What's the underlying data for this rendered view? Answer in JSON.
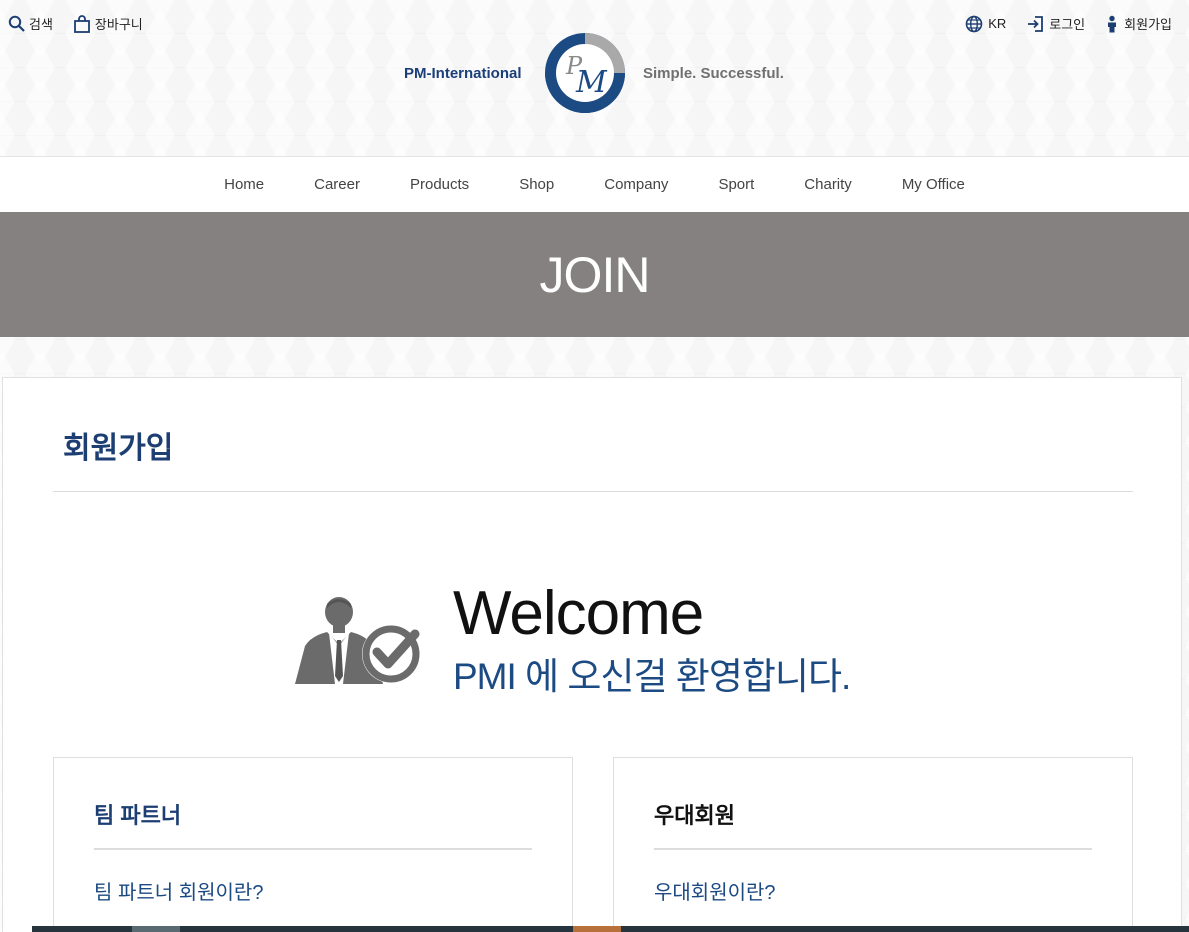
{
  "utility": {
    "search_label": "검색",
    "cart_label": "장바구니",
    "language_label": "KR",
    "login_label": "로그인",
    "signup_label": "회원가입"
  },
  "brand": {
    "left_text": "PM-International",
    "right_text": "Simple. Successful.",
    "primary_color": "#1c3e72",
    "secondary_color": "#a0a0a0"
  },
  "nav": {
    "items": [
      "Home",
      "Career",
      "Products",
      "Shop",
      "Company",
      "Sport",
      "Charity",
      "My Office"
    ]
  },
  "hero": {
    "title": "JOIN"
  },
  "main": {
    "page_title": "회원가입",
    "welcome_title": "Welcome",
    "welcome_subtitle": "PMI 에 오신걸 환영합니다.",
    "boxes": [
      {
        "title": "팀 파트너",
        "link": "팀 파트너 회원이란?"
      },
      {
        "title": "우대회원",
        "link": "우대회원이란?"
      }
    ]
  }
}
